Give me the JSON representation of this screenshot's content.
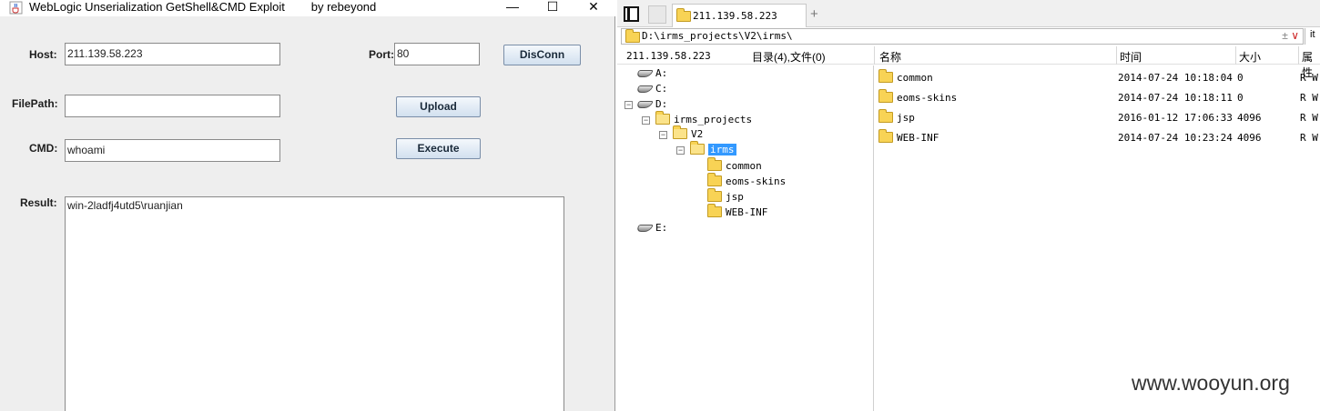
{
  "exploit_window": {
    "title": "WebLogic Unserialization GetShell&CMD Exploit        by rebeyond",
    "host_label": "Host:",
    "host_value": "211.139.58.223",
    "port_label": "Port:",
    "port_value": "80",
    "disconn_button": "DisConn",
    "filepath_label": "FilePath:",
    "filepath_value": "",
    "upload_button": "Upload",
    "cmd_label": "CMD:",
    "cmd_value": "whoami",
    "execute_button": "Execute",
    "result_label": "Result:",
    "result_value": "win-2ladfj4utd5\\ruanjian",
    "window_controls": {
      "minimize": "—",
      "maximize": "☐",
      "close": "✕"
    }
  },
  "file_manager": {
    "tab_title": "211.139.58.223",
    "tab_add": "+",
    "path": "D:\\irms_projects\\V2\\irms\\",
    "path_controls": {
      "up": "±",
      "down": "∨"
    },
    "path_extra": "it",
    "host": "211.139.58.223",
    "summary": "目录(4),文件(0)",
    "columns": {
      "name": "名称",
      "time": "时间",
      "size": "大小",
      "attr": "属性"
    },
    "tree": [
      {
        "label": "A:",
        "type": "drive"
      },
      {
        "label": "C:",
        "type": "drive"
      },
      {
        "label": "D:",
        "type": "drive",
        "expander": "−"
      },
      {
        "label": "irms_projects",
        "type": "folder",
        "expander": "−"
      },
      {
        "label": "V2",
        "type": "folder",
        "expander": "−"
      },
      {
        "label": "irms",
        "type": "folder",
        "expander": "−",
        "selected": true
      },
      {
        "label": "common",
        "type": "folder"
      },
      {
        "label": "eoms-skins",
        "type": "folder"
      },
      {
        "label": "jsp",
        "type": "folder"
      },
      {
        "label": "WEB-INF",
        "type": "folder"
      },
      {
        "label": "E:",
        "type": "drive"
      }
    ],
    "files": [
      {
        "name": "common",
        "time": "2014-07-24 10:18:04",
        "size": "0",
        "attr": "R W"
      },
      {
        "name": "eoms-skins",
        "time": "2014-07-24 10:18:11",
        "size": "0",
        "attr": "R W"
      },
      {
        "name": "jsp",
        "time": "2016-01-12 17:06:33",
        "size": "4096",
        "attr": "R W"
      },
      {
        "name": "WEB-INF",
        "time": "2014-07-24 10:23:24",
        "size": "4096",
        "attr": "R W"
      }
    ]
  },
  "watermark": "www.wooyun.org",
  "colors": {
    "selection": "#3399ff",
    "folder": "#f8d355",
    "window_bg": "#eeeeee"
  }
}
